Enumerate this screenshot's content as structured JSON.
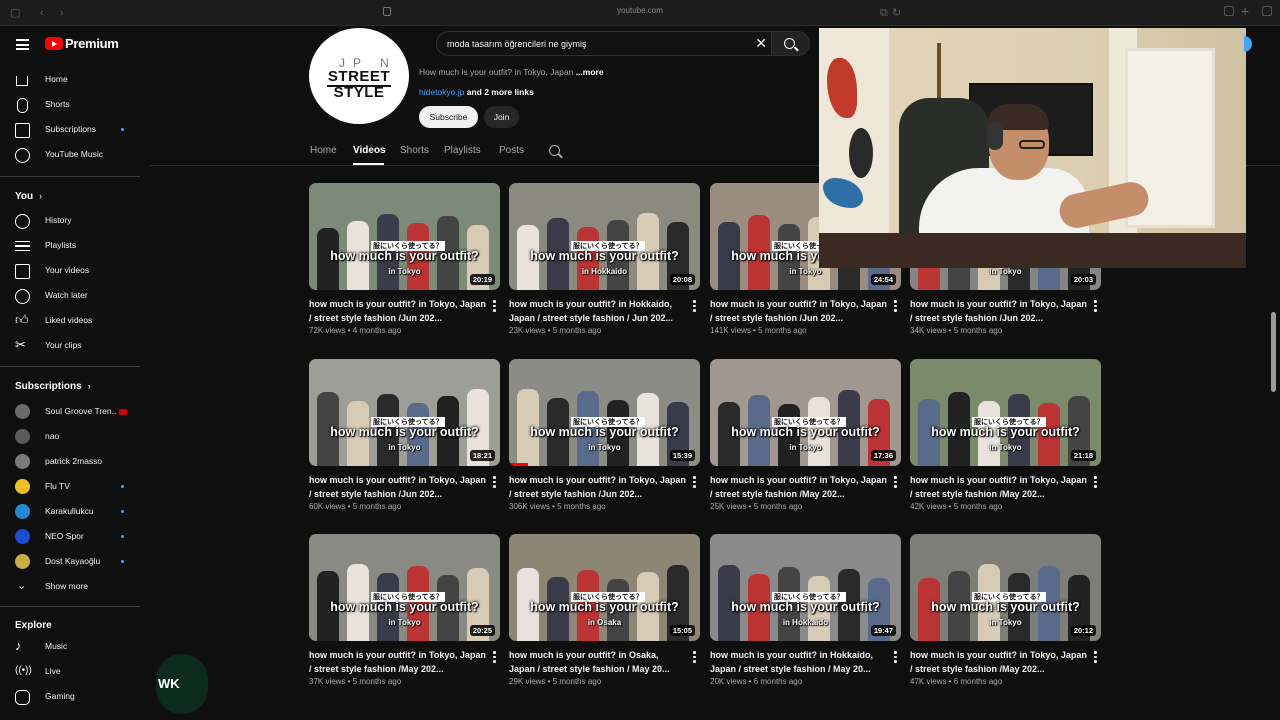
{
  "browser": {
    "url": "youtube.com"
  },
  "header": {
    "brand": "Premium"
  },
  "search": {
    "query": "moda tasarım öğrencileri ne giymiş"
  },
  "sidebar": {
    "main": [
      {
        "label": "Home",
        "icon": "home-icon"
      },
      {
        "label": "Shorts",
        "icon": "shorts-icon"
      },
      {
        "label": "Subscriptions",
        "icon": "subscriptions-icon",
        "dot": true
      },
      {
        "label": "YouTube Music",
        "icon": "music-circle-icon"
      }
    ],
    "you_heading": "You",
    "you": [
      {
        "label": "History",
        "icon": "history-icon"
      },
      {
        "label": "Playlists",
        "icon": "playlists-icon"
      },
      {
        "label": "Your videos",
        "icon": "your-videos-icon"
      },
      {
        "label": "Watch later",
        "icon": "clock-icon"
      },
      {
        "label": "Liked videos",
        "icon": "thumbs-up-icon"
      },
      {
        "label": "Your clips",
        "icon": "scissors-icon"
      }
    ],
    "subs_heading": "Subscriptions",
    "subs": [
      {
        "label": "Soul Groove Tren...",
        "color": "#6a6a6a",
        "live": true
      },
      {
        "label": "nao",
        "color": "#5a5a5a"
      },
      {
        "label": "patrick 2masso",
        "color": "#7a7a7a"
      },
      {
        "label": "Flu TV",
        "color": "#f0c020",
        "dot": true
      },
      {
        "label": "Karakullukcu",
        "color": "#1e8bd6",
        "dot": true
      },
      {
        "label": "NEO Spor",
        "color": "#1a4fd0",
        "dot": true
      },
      {
        "label": "Dost Kayaoğlu",
        "color": "#c8b040",
        "dot": true
      }
    ],
    "show_more": "Show more",
    "explore_heading": "Explore",
    "explore": [
      {
        "label": "Music",
        "icon": "music-note-icon"
      },
      {
        "label": "Live",
        "icon": "live-icon"
      },
      {
        "label": "Gaming",
        "icon": "gaming-icon"
      }
    ]
  },
  "channel": {
    "avatar_top": "JP N",
    "avatar_line1": "STREET",
    "avatar_line2": "STYLE",
    "desc": "How much is your outfit? in Tokyo, Japan ",
    "more": "...more",
    "link": "hidetokyo.jp",
    "more_links": " and 2 more links",
    "subscribe": "Subscribe",
    "join": "Join",
    "tabs": [
      "Home",
      "Videos",
      "Shorts",
      "Playlists",
      "Posts"
    ]
  },
  "video_caption": "how much is your outfit?",
  "video_caption_jp": "服にいくら使ってる？",
  "videos": [
    {
      "title": "how much is your outfit? in Tokyo, Japan / street style fashion /Jun 202...",
      "views": "72K views",
      "age": "4 months ago",
      "duration": "20:19",
      "city": "in Tokyo",
      "bg": "#7d8a78"
    },
    {
      "title": "how much is your outfit? in Hokkaido, Japan / street style fashion / Jun 202...",
      "views": "23K views",
      "age": "5 months ago",
      "duration": "20:08",
      "city": "in Hokkaido",
      "bg": "#8a8a7e"
    },
    {
      "title": "how much is your outfit? in Tokyo, Japan / street style fashion /Jun 202...",
      "views": "141K views",
      "age": "5 months ago",
      "duration": "24:54",
      "city": "in Tokyo",
      "bg": "#9a8d80"
    },
    {
      "title": "how much is your outfit? in Tokyo, Japan / street style fashion /Jun 202...",
      "views": "34K views",
      "age": "5 months ago",
      "duration": "20:03",
      "city": "in Tokyo",
      "bg": "#858585"
    },
    {
      "title": "how much is your outfit? in Tokyo, Japan / street style fashion /Jun 202...",
      "views": "60K views",
      "age": "5 months ago",
      "duration": "18:21",
      "city": "in Tokyo",
      "bg": "#9e9e98"
    },
    {
      "title": "how much is your outfit? in Tokyo, Japan / street style fashion /Jun 202...",
      "views": "306K views",
      "age": "5 months ago",
      "duration": "15:39",
      "city": "in Tokyo",
      "bg": "#8c8c86",
      "progress": 0.1
    },
    {
      "title": "how much is your outfit? in Tokyo, Japan / street style fashion /May 202...",
      "views": "25K views",
      "age": "5 months ago",
      "duration": "17:36",
      "city": "in Tokyo",
      "bg": "#a09890"
    },
    {
      "title": "how much is your outfit? in Tokyo, Japan / street style fashion /May 202...",
      "views": "42K views",
      "age": "5 months ago",
      "duration": "21:18",
      "city": "in Tokyo",
      "bg": "#7a8a6a"
    },
    {
      "title": "how much is your outfit? in Tokyo, Japan / street style fashion /May 202...",
      "views": "37K views",
      "age": "5 months ago",
      "duration": "20:25",
      "city": "in Tokyo",
      "bg": "#8a8a84"
    },
    {
      "title": "how much is your outfit? in Osaka, Japan / street style fashion / May 20...",
      "views": "29K views",
      "age": "5 months ago",
      "duration": "15:05",
      "city": "in Osaka",
      "bg": "#8e8674"
    },
    {
      "title": "how much is your outfit? in Hokkaido, Japan / street style fashion / May 20...",
      "views": "20K views",
      "age": "6 months ago",
      "duration": "19:47",
      "city": "in Hokkaido",
      "bg": "#8a8a8a"
    },
    {
      "title": "how much is your outfit? in Tokyo, Japan / street style fashion /May 202...",
      "views": "47K views",
      "age": "6 months ago",
      "duration": "20:12",
      "city": "in Tokyo",
      "bg": "#7e7e78"
    }
  ],
  "floating": {
    "text": "WK"
  }
}
